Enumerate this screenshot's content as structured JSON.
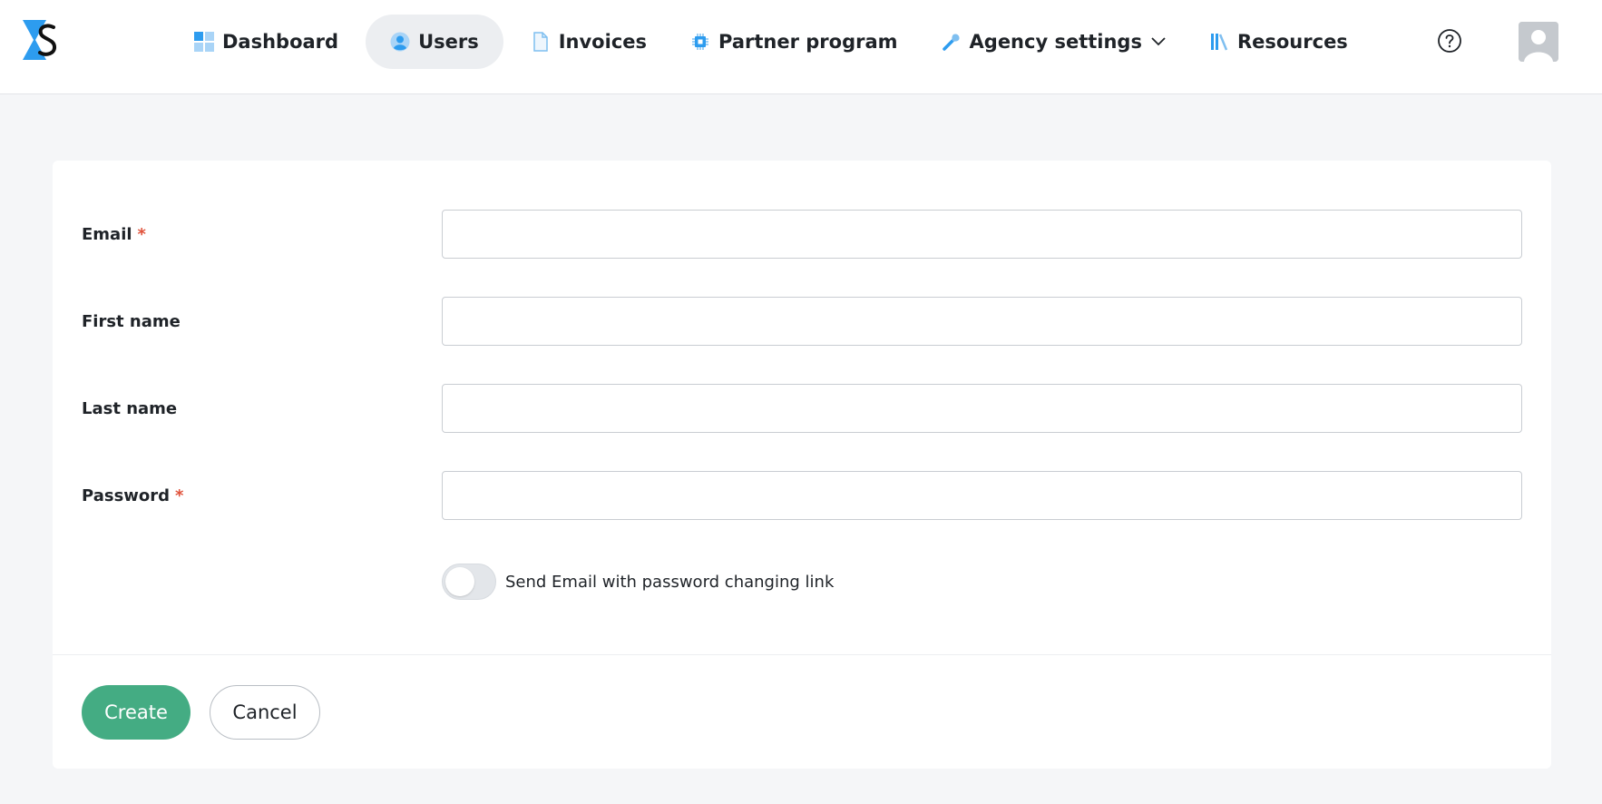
{
  "nav": {
    "items": [
      {
        "label": "Dashboard",
        "icon": "dashboard-icon"
      },
      {
        "label": "Users",
        "icon": "user-icon",
        "active": true
      },
      {
        "label": "Invoices",
        "icon": "document-icon"
      },
      {
        "label": "Partner program",
        "icon": "chip-icon"
      },
      {
        "label": "Agency settings",
        "icon": "wrench-icon",
        "has_dropdown": true
      },
      {
        "label": "Resources",
        "icon": "library-icon"
      }
    ]
  },
  "header": {
    "help_icon": "help-icon",
    "avatar_icon": "avatar-icon"
  },
  "form": {
    "email_label": "Email",
    "first_name_label": "First name",
    "last_name_label": "Last name",
    "password_label": "Password",
    "required_mark": "*",
    "email_value": "",
    "first_name_value": "",
    "last_name_value": "",
    "password_value": "",
    "toggle_label": "Send Email with password changing link",
    "toggle_on": false
  },
  "actions": {
    "create_label": "Create",
    "cancel_label": "Cancel"
  },
  "colors": {
    "accent": "#44ac83",
    "brand_blue": "#2d9cef",
    "required": "#e0523b"
  }
}
